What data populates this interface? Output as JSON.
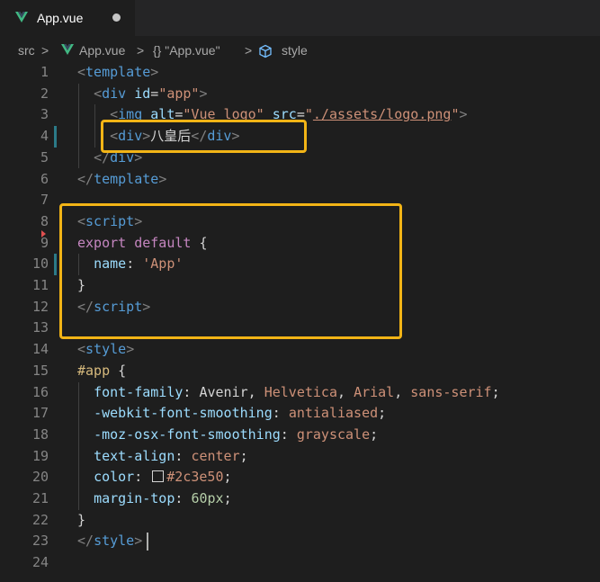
{
  "tab": {
    "title": "App.vue",
    "vue_icon": "vue-logo-icon",
    "dirty_icon": "unsaved-dot-icon"
  },
  "breadcrumbs": {
    "folder": "src",
    "file": "App.vue",
    "object": "{} \"App.vue\"",
    "symbol": "style",
    "separator": ">",
    "symbol_icon": "cube-icon"
  },
  "colors": {
    "highlight_box": "#f2b416",
    "background": "#1e1e1e"
  },
  "lines": [
    {
      "n": "1"
    },
    {
      "n": "2"
    },
    {
      "n": "3"
    },
    {
      "n": "4"
    },
    {
      "n": "5"
    },
    {
      "n": "6"
    },
    {
      "n": "7"
    },
    {
      "n": "8"
    },
    {
      "n": "9"
    },
    {
      "n": "10"
    },
    {
      "n": "11"
    },
    {
      "n": "12"
    },
    {
      "n": "13"
    },
    {
      "n": "14"
    },
    {
      "n": "15"
    },
    {
      "n": "16"
    },
    {
      "n": "17"
    },
    {
      "n": "18"
    },
    {
      "n": "19"
    },
    {
      "n": "20"
    },
    {
      "n": "21"
    },
    {
      "n": "22"
    },
    {
      "n": "23"
    },
    {
      "n": "24"
    }
  ],
  "code": [
    [
      [
        "t-pu",
        "<"
      ],
      [
        "t-tag",
        "template"
      ],
      [
        "t-pu",
        ">"
      ]
    ],
    [
      [
        "t-txt",
        "  "
      ],
      [
        "t-pu",
        "<"
      ],
      [
        "t-tag",
        "div"
      ],
      [
        "t-txt",
        " "
      ],
      [
        "t-attr",
        "id"
      ],
      [
        "t-txt",
        "="
      ],
      [
        "t-str",
        "\"app\""
      ],
      [
        "t-pu",
        ">"
      ]
    ],
    [
      [
        "t-txt",
        "    "
      ],
      [
        "t-pu",
        "<"
      ],
      [
        "t-tag",
        "img"
      ],
      [
        "t-txt",
        " "
      ],
      [
        "t-attr",
        "alt"
      ],
      [
        "t-txt",
        "="
      ],
      [
        "t-str",
        "\"Vue logo\""
      ],
      [
        "t-txt",
        " "
      ],
      [
        "t-attr",
        "src"
      ],
      [
        "t-txt",
        "="
      ],
      [
        "t-str",
        "\""
      ],
      [
        "t-str u",
        "./assets/logo.png"
      ],
      [
        "t-str",
        "\""
      ],
      [
        "t-pu",
        ">"
      ]
    ],
    [
      [
        "t-txt",
        "    "
      ],
      [
        "t-pu",
        "<"
      ],
      [
        "t-tag",
        "div"
      ],
      [
        "t-pu",
        ">"
      ],
      [
        "t-txt",
        "八皇后"
      ],
      [
        "t-pu",
        "</"
      ],
      [
        "t-tag",
        "div"
      ],
      [
        "t-pu",
        ">"
      ]
    ],
    [
      [
        "t-txt",
        "  "
      ],
      [
        "t-pu",
        "</"
      ],
      [
        "t-tag",
        "div"
      ],
      [
        "t-pu",
        ">"
      ]
    ],
    [
      [
        "t-pu",
        "</"
      ],
      [
        "t-tag",
        "template"
      ],
      [
        "t-pu",
        ">"
      ]
    ],
    [],
    [
      [
        "t-pu",
        "<"
      ],
      [
        "t-tag",
        "script"
      ],
      [
        "t-pu",
        ">"
      ]
    ],
    [
      [
        "t-kw",
        "export"
      ],
      [
        "t-txt",
        " "
      ],
      [
        "t-kw",
        "default"
      ],
      [
        "t-txt",
        " {"
      ]
    ],
    [
      [
        "t-txt",
        "  "
      ],
      [
        "t-prop",
        "name"
      ],
      [
        "t-txt",
        ": "
      ],
      [
        "t-str",
        "'App'"
      ]
    ],
    [
      [
        "t-txt",
        "}"
      ]
    ],
    [
      [
        "t-pu",
        "</"
      ],
      [
        "t-tag",
        "script"
      ],
      [
        "t-pu",
        ">"
      ]
    ],
    [],
    [
      [
        "t-pu",
        "<"
      ],
      [
        "t-tag",
        "style"
      ],
      [
        "t-pu",
        ">"
      ]
    ],
    [
      [
        "t-sel",
        "#app"
      ],
      [
        "t-txt",
        " {"
      ]
    ],
    [
      [
        "t-txt",
        "  "
      ],
      [
        "t-prop",
        "font-family"
      ],
      [
        "t-txt",
        ": Avenir, "
      ],
      [
        "t-val",
        "Helvetica"
      ],
      [
        "t-txt",
        ", "
      ],
      [
        "t-val",
        "Arial"
      ],
      [
        "t-txt",
        ", "
      ],
      [
        "t-val",
        "sans-serif"
      ],
      [
        "t-txt",
        ";"
      ]
    ],
    [
      [
        "t-txt",
        "  "
      ],
      [
        "t-prop",
        "-webkit-font-smoothing"
      ],
      [
        "t-txt",
        ": "
      ],
      [
        "t-val",
        "antialiased"
      ],
      [
        "t-txt",
        ";"
      ]
    ],
    [
      [
        "t-txt",
        "  "
      ],
      [
        "t-prop",
        "-moz-osx-font-smoothing"
      ],
      [
        "t-txt",
        ": "
      ],
      [
        "t-val",
        "grayscale"
      ],
      [
        "t-txt",
        ";"
      ]
    ],
    [
      [
        "t-txt",
        "  "
      ],
      [
        "t-prop",
        "text-align"
      ],
      [
        "t-txt",
        ": "
      ],
      [
        "t-val",
        "center"
      ],
      [
        "t-txt",
        ";"
      ]
    ],
    [
      [
        "t-txt",
        "  "
      ],
      [
        "t-prop",
        "color"
      ],
      [
        "t-txt",
        ": "
      ],
      [
        "swatch",
        ""
      ],
      [
        "t-val",
        "#2c3e50"
      ],
      [
        "t-txt",
        ";"
      ]
    ],
    [
      [
        "t-txt",
        "  "
      ],
      [
        "t-prop",
        "margin-top"
      ],
      [
        "t-txt",
        ": "
      ],
      [
        "t-num",
        "60px"
      ],
      [
        "t-txt",
        ";"
      ]
    ],
    [
      [
        "t-txt",
        "}"
      ]
    ],
    [
      [
        "t-pu",
        "</"
      ],
      [
        "t-tag",
        "style"
      ],
      [
        "t-pu",
        ">"
      ]
    ],
    []
  ]
}
